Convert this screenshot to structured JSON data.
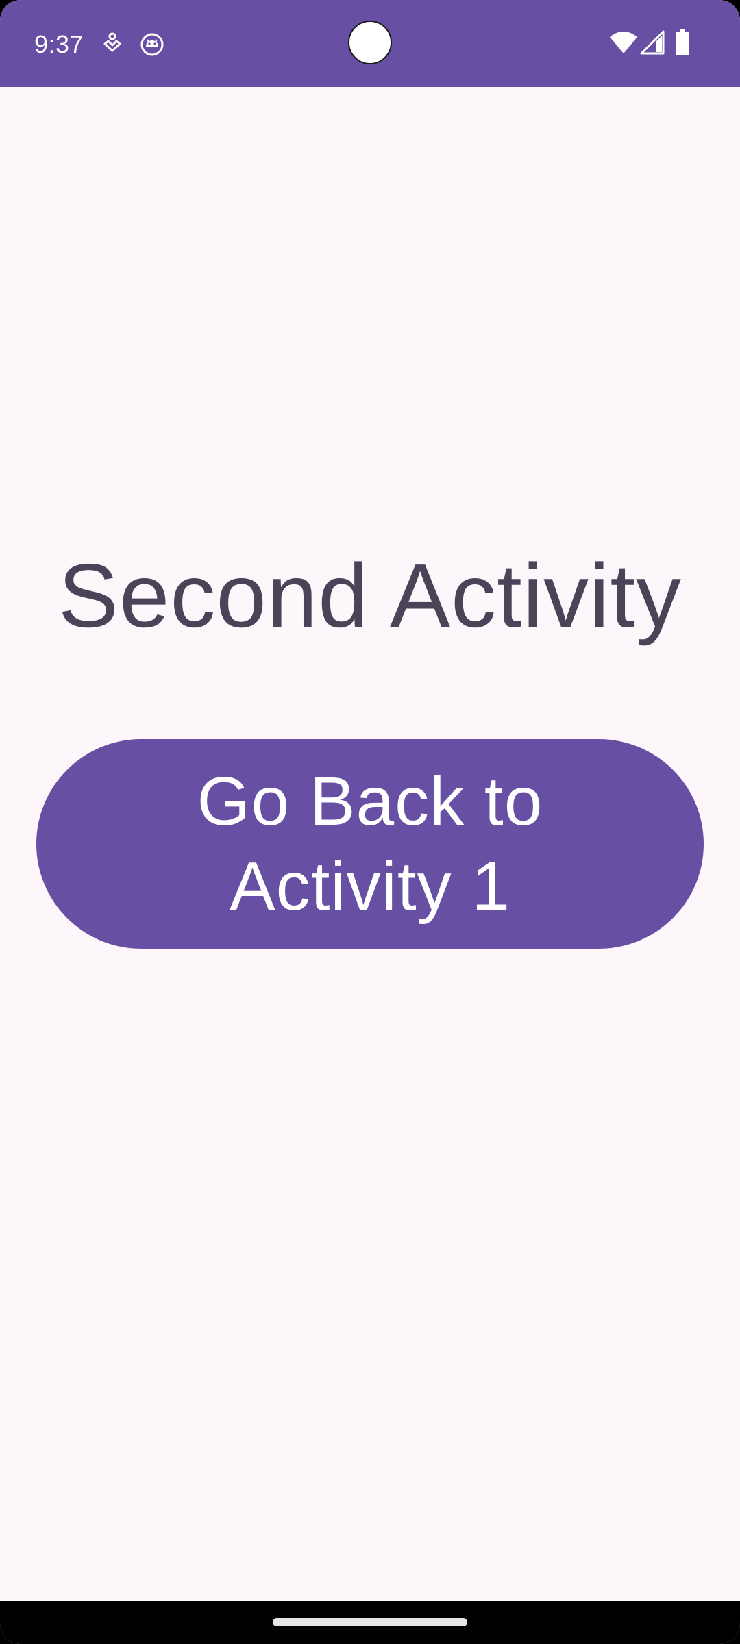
{
  "status_bar": {
    "time": "9:37",
    "notification_icons": [
      "accessibility-icon",
      "android-robot-icon"
    ],
    "system_icons": [
      "wifi-icon",
      "cellular-signal-icon",
      "battery-icon"
    ]
  },
  "main": {
    "title": "Second Activity",
    "back_button_label": "Go Back to Activity 1"
  },
  "colors": {
    "primary": "#6750A4",
    "background": "#FDF7FC",
    "title_text": "#4A4458",
    "on_primary": "#FFFFFF"
  }
}
